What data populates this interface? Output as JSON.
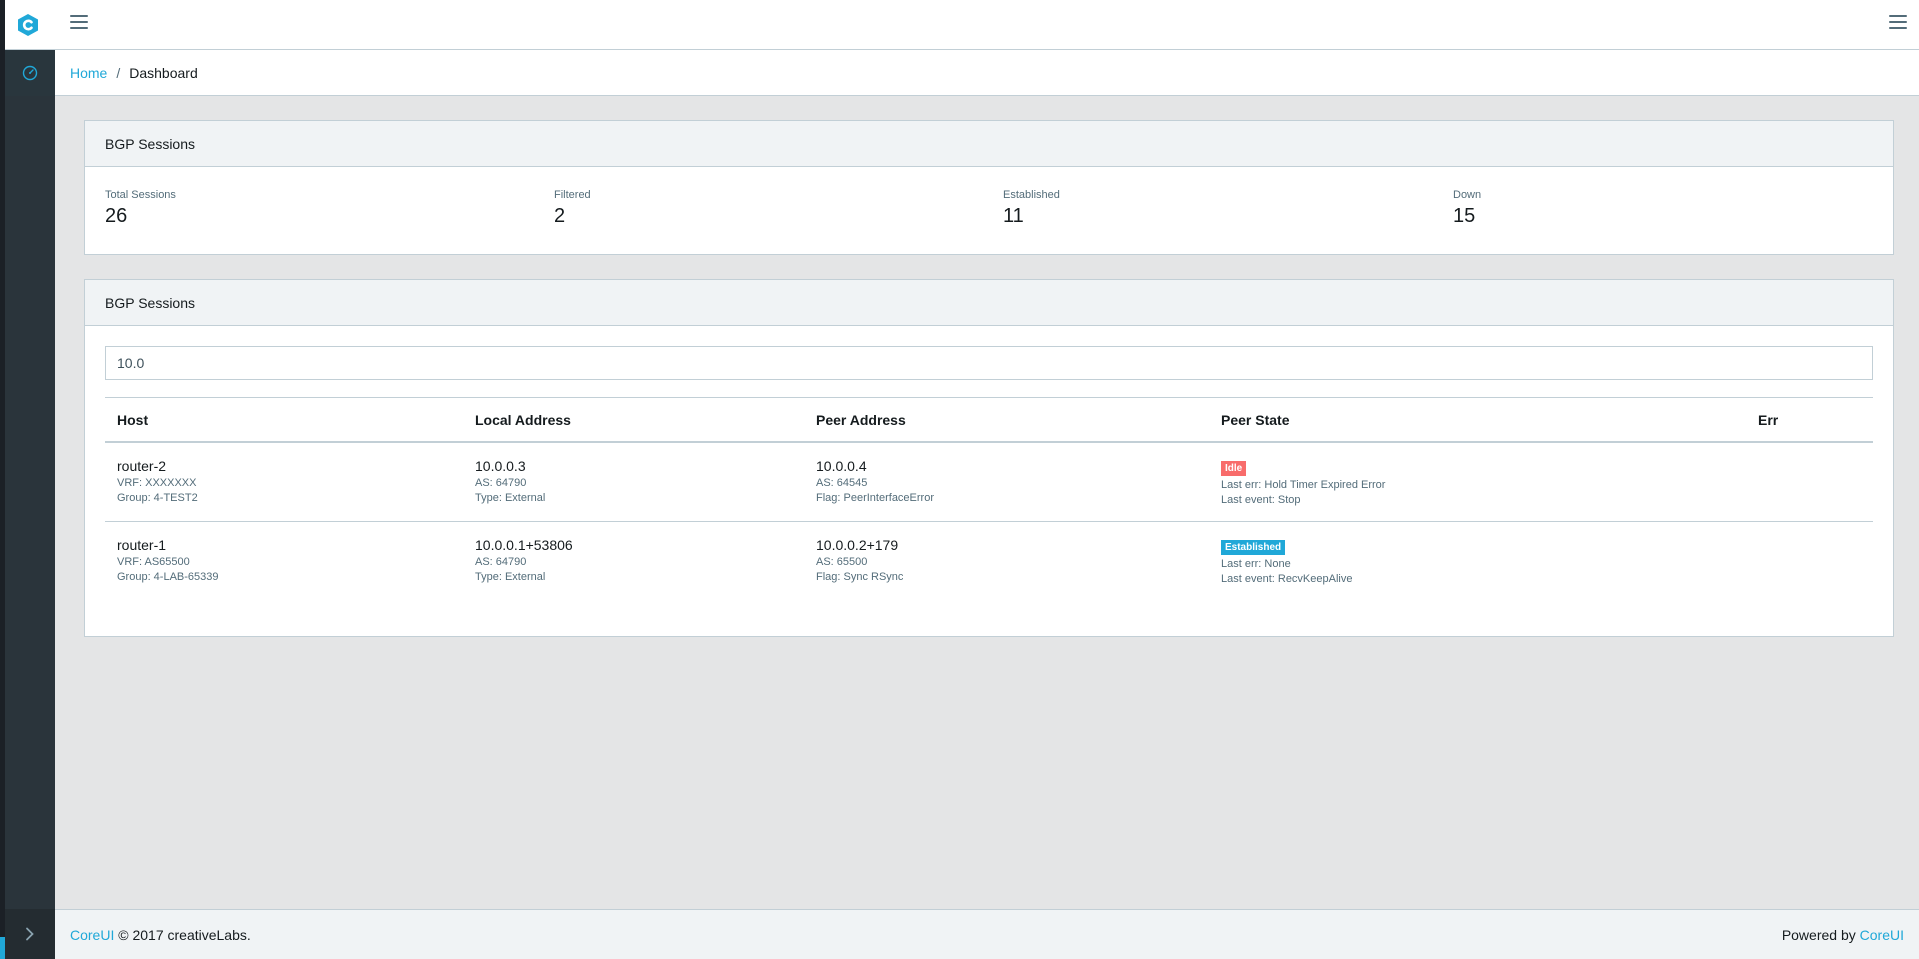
{
  "colors": {
    "accent": "#20a8d8",
    "danger": "#f86c6b",
    "sidebar": "#2a343b"
  },
  "header": {
    "logo_icon": "coreui-logo-icon",
    "menu_icon": "hamburger-icon"
  },
  "sidebar": {
    "items": [
      {
        "icon": "speedometer-icon"
      }
    ],
    "minimizer_icon": "chevron-right-icon"
  },
  "breadcrumb": {
    "home": "Home",
    "separator": "/",
    "current": "Dashboard"
  },
  "summary_card": {
    "title": "BGP Sessions",
    "stats": [
      {
        "label": "Total Sessions",
        "value": "26"
      },
      {
        "label": "Filtered",
        "value": "2"
      },
      {
        "label": "Established",
        "value": "11"
      },
      {
        "label": "Down",
        "value": "15"
      }
    ]
  },
  "sessions_card": {
    "title": "BGP Sessions",
    "filter_value": "10.0",
    "columns": [
      "Host",
      "Local Address",
      "Peer Address",
      "Peer State",
      "Err"
    ],
    "rows": [
      {
        "host": "router-2",
        "vrf": "VRF: XXXXXXX",
        "group": "Group: 4-TEST2",
        "local_address": "10.0.0.3",
        "local_as": "AS: 64790",
        "local_type": "Type: External",
        "peer_address": "10.0.0.4",
        "peer_as": "AS: 64545",
        "peer_flag": "Flag: PeerInterfaceError",
        "state": "Idle",
        "last_err": "Last err: Hold Timer Expired Error",
        "last_event": "Last event: Stop",
        "err": ""
      },
      {
        "host": "router-1",
        "vrf": "VRF: AS65500",
        "group": "Group: 4-LAB-65339",
        "local_address": "10.0.0.1+53806",
        "local_as": "AS: 64790",
        "local_type": "Type: External",
        "peer_address": "10.0.0.2+179",
        "peer_as": "AS: 65500",
        "peer_flag": "Flag: Sync RSync",
        "state": "Established",
        "last_err": "Last err: None",
        "last_event": "Last event: RecvKeepAlive",
        "err": ""
      }
    ]
  },
  "footer": {
    "brand_link": "CoreUI",
    "copyright": "© 2017 creativeLabs.",
    "powered_by": "Powered by",
    "powered_link": "CoreUI"
  }
}
